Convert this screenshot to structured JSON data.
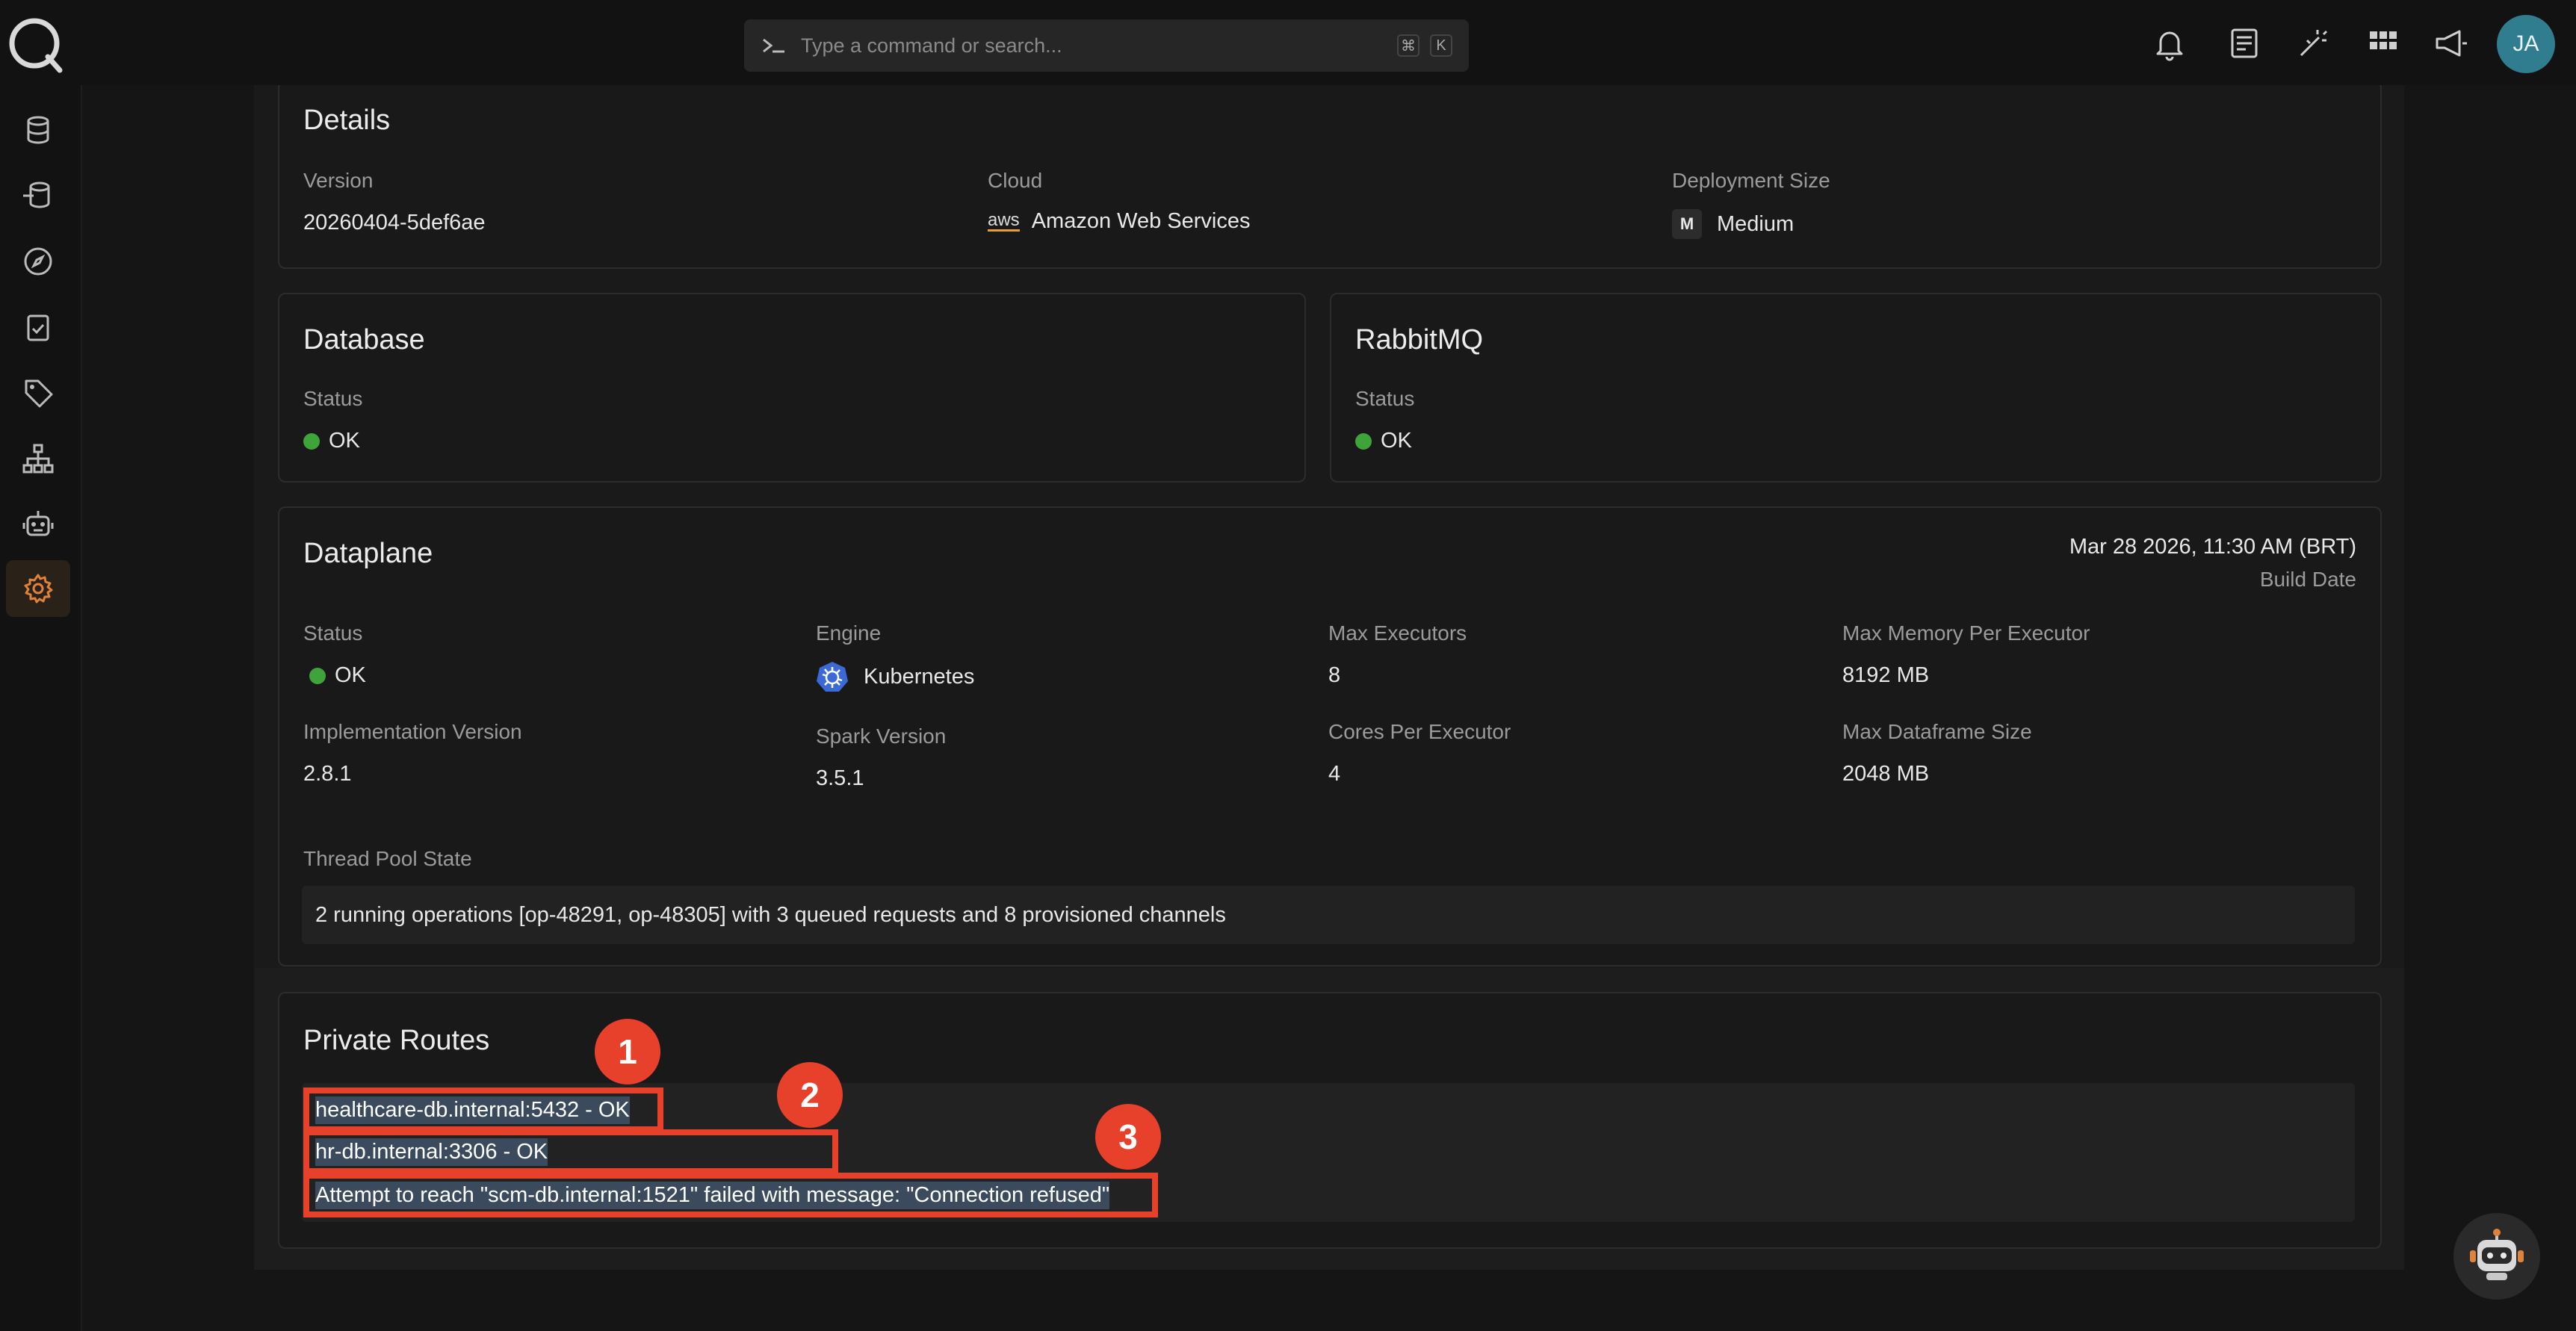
{
  "topbar": {
    "search_placeholder": "Type a command or search...",
    "shortcut_keys": [
      "⌘",
      "K"
    ],
    "avatar_initials": "JA"
  },
  "details": {
    "title": "Details",
    "version_label": "Version",
    "version_value": "20260404-5def6ae",
    "cloud_label": "Cloud",
    "cloud_logo_text": "aws",
    "cloud_value": "Amazon Web Services",
    "size_label": "Deployment Size",
    "size_icon_text": "M",
    "size_value": "Medium"
  },
  "database": {
    "title": "Database",
    "status_label": "Status",
    "status_value": "OK"
  },
  "rabbitmq": {
    "title": "RabbitMQ",
    "status_label": "Status",
    "status_value": "OK"
  },
  "dataplane": {
    "title": "Dataplane",
    "build_date": "Mar 28 2026, 11:30 AM (BRT)",
    "build_date_label": "Build Date",
    "status_label": "Status",
    "status_value": "OK",
    "engine_label": "Engine",
    "engine_value": "Kubernetes",
    "max_executors_label": "Max Executors",
    "max_executors_value": "8",
    "max_memory_label": "Max Memory Per Executor",
    "max_memory_value": "8192 MB",
    "impl_version_label": "Implementation Version",
    "impl_version_value": "2.8.1",
    "spark_version_label": "Spark Version",
    "spark_version_value": "3.5.1",
    "cores_label": "Cores Per Executor",
    "cores_value": "4",
    "max_df_label": "Max Dataframe Size",
    "max_df_value": "2048 MB",
    "thread_pool_label": "Thread Pool State",
    "thread_pool_value": "2 running operations [op-48291, op-48305] with 3 queued requests and 8 provisioned channels"
  },
  "private_routes": {
    "title": "Private Routes",
    "routes": [
      "healthcare-db.internal:5432 - OK",
      "hr-db.internal:3306 - OK",
      "Attempt to reach \"scm-db.internal:1521\" failed with message: \"Connection refused\""
    ],
    "badges": [
      "1",
      "2",
      "3"
    ]
  },
  "colors": {
    "status_ok": "#3ea43a",
    "highlight": "#e8412b",
    "active_nav": "#e0833a"
  }
}
